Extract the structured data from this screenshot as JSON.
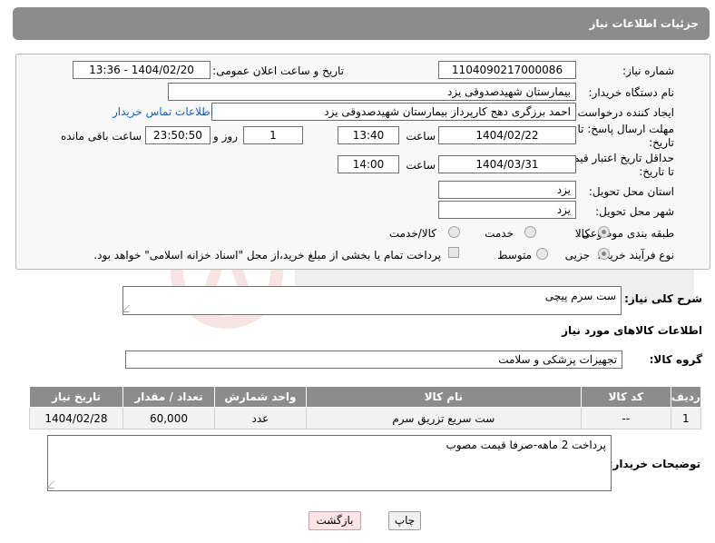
{
  "header": {
    "title": "جزئیات اطلاعات نیاز"
  },
  "form": {
    "need_number_label": "شماره نیاز:",
    "need_number": "1104090217000086",
    "announce_label": "تاریخ و ساعت اعلان عمومی:",
    "announce_value": "1404/02/20 - 13:36",
    "buyer_org_label": "نام دستگاه خریدار:",
    "buyer_org": "بیمارستان شهیدصدوقی یزد",
    "creator_label": "ایجاد کننده درخواست:",
    "creator": "احمد برزگری دهج کارپرداز بیمارستان شهیدصدوقی یزد",
    "contact_link": "اطلاعات تماس خریدار",
    "reply_deadline_label_1": "مهلت ارسال پاسخ: تا",
    "reply_deadline_label_2": "تاریخ:",
    "reply_date": "1404/02/22",
    "time_label": "ساعت",
    "reply_time": "13:40",
    "days_value": "1",
    "days_label": "روز و",
    "remaining_time": "23:50:50",
    "remaining_label": "ساعت باقی مانده",
    "price_validity_label_1": "حداقل تاریخ اعتبار قیمت:",
    "price_validity_label_2": "تا تاریخ:",
    "price_date": "1404/03/31",
    "price_time": "14:00",
    "province_label": "استان محل تحویل:",
    "province": "یزد",
    "city_label": "شهر محل تحویل:",
    "city": "یزد",
    "category_label": "طبقه بندی موضوعی:",
    "category_options": [
      "کالا",
      "خدمت",
      "کالا/خدمت"
    ],
    "process_label": "نوع فرآیند خرید :",
    "process_options": [
      "جزیی",
      "متوسط"
    ],
    "payment_note": "پرداخت تمام یا بخشی از مبلغ خرید،از محل \"اسناد خزانه اسلامی\" خواهد بود."
  },
  "summary": {
    "label": "شرح کلی نیاز:",
    "value": "ست سرم پیچی"
  },
  "goods": {
    "section_title": "اطلاعات کالاهای مورد نیاز",
    "group_label": "گروه کالا:",
    "group_value": "تجهیزات پزشکی و سلامت",
    "columns": [
      "ردیف",
      "کد کالا",
      "نام کالا",
      "واحد شمارش",
      "تعداد / مقدار",
      "تاریخ نیاز"
    ],
    "rows": [
      [
        "1",
        "--",
        "ست سریع تزریق سرم",
        "عدد",
        "60,000",
        "1404/02/28"
      ]
    ]
  },
  "buyer_notes": {
    "label": "توضیحات خریدار:",
    "value": "پرداخت 2 ماهه-صرفا قیمت مصوب"
  },
  "buttons": {
    "print": "چاپ",
    "back": "بازگشت"
  }
}
